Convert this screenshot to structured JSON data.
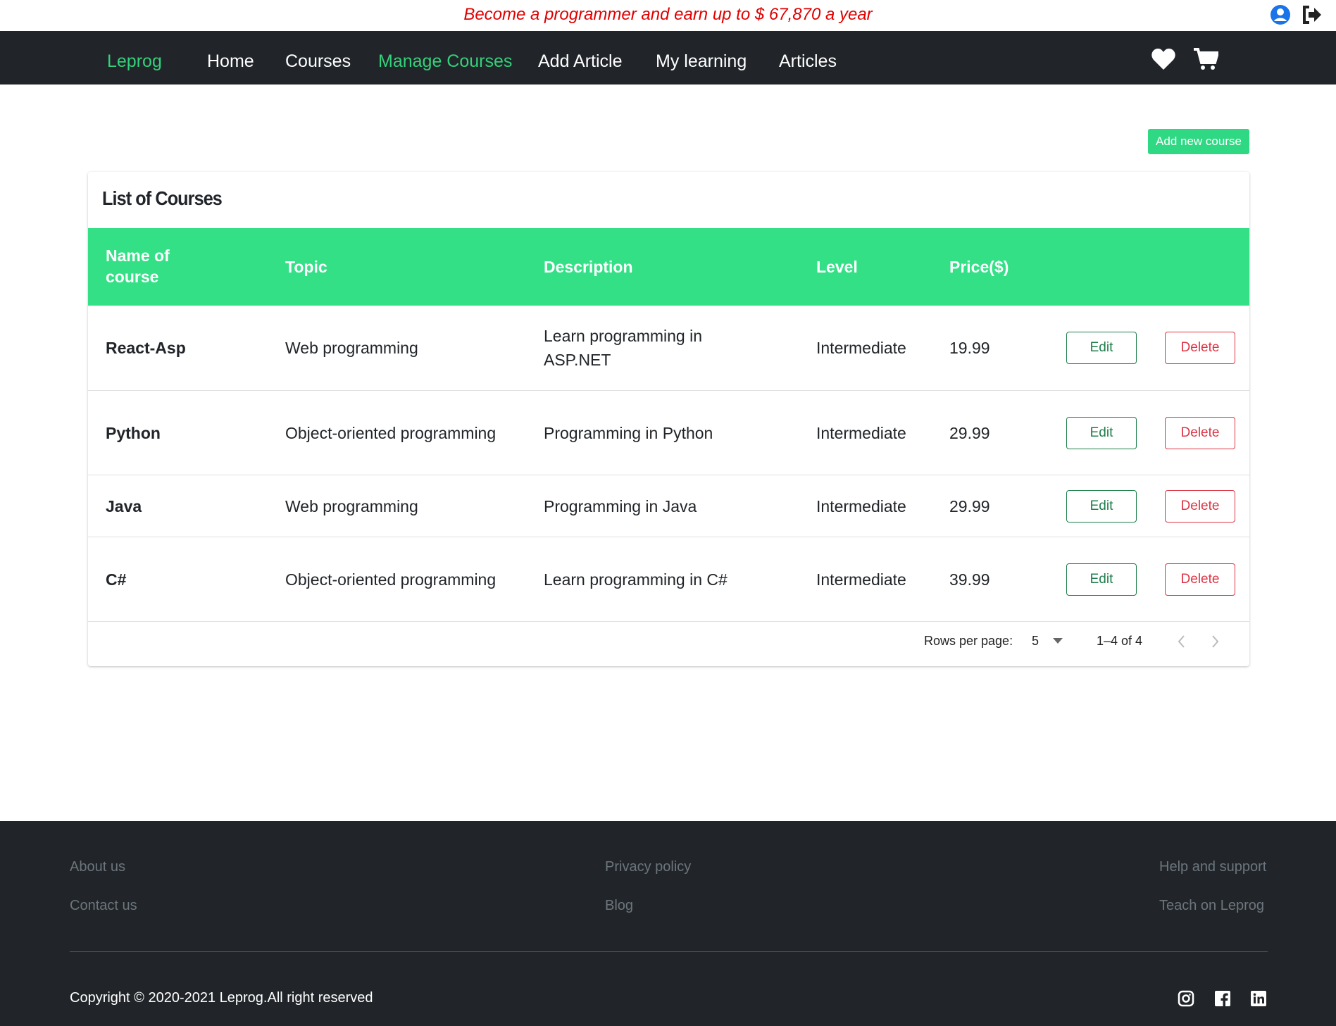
{
  "banner": {
    "text": "Become a programmer and earn up to $ 67,870 a year"
  },
  "nav": {
    "brand": "Leprog",
    "items": [
      "Home",
      "Courses",
      "Manage Courses",
      "Add Article",
      "My learning",
      "Articles"
    ],
    "active": "Manage Courses"
  },
  "actions": {
    "add_course": "Add new course"
  },
  "table": {
    "title": "List of Courses",
    "headers": [
      "Name of course",
      "Topic",
      "Description",
      "Level",
      "Price($)"
    ],
    "rows": [
      {
        "name": "React-Asp",
        "topic": "Web programming",
        "description": "Learn programming in ASP.NET",
        "level": "Intermediate",
        "price": "19.99"
      },
      {
        "name": "Python",
        "topic": "Object-oriented programming",
        "description": "Programming in Python",
        "level": "Intermediate",
        "price": "29.99"
      },
      {
        "name": "Java",
        "topic": "Web programming",
        "description": "Programming in Java",
        "level": "Intermediate",
        "price": "29.99"
      },
      {
        "name": "C#",
        "topic": "Object-oriented programming",
        "description": "Learn programming in C#",
        "level": "Intermediate",
        "price": "39.99"
      }
    ],
    "edit_label": "Edit",
    "delete_label": "Delete"
  },
  "pagination": {
    "rows_per_page_label": "Rows per page:",
    "rows_per_page": "5",
    "range": "1–4 of 4"
  },
  "footer": {
    "links": [
      "About us",
      "Contact us",
      "Privacy policy",
      "Blog",
      "Help and support",
      "Teach on Leprog"
    ],
    "copyright": "Copyright © 2020-2021 Leprog.All right reserved"
  },
  "colors": {
    "accent": "#33e086",
    "nav_bg": "#212529",
    "banner_text": "#e00000",
    "delete": "#dc3545"
  }
}
